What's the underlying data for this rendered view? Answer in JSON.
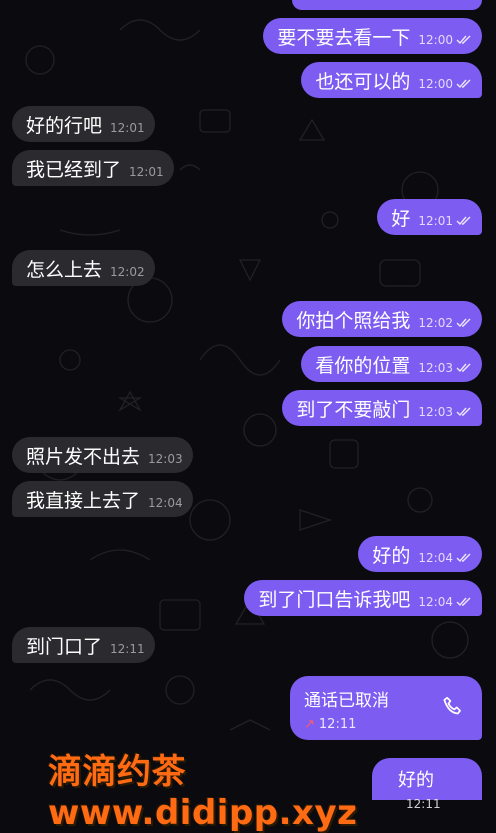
{
  "colors": {
    "outgoing": "#7d5cf2",
    "incoming": "#2a2a2f",
    "background": "#0b0b0f",
    "missed": "#ff5b6b",
    "watermark": "#ff6a13"
  },
  "messages": [
    {
      "text": "要不要去看一下",
      "time": "12:00",
      "dir": "out"
    },
    {
      "text": "也还可以的",
      "time": "12:00",
      "dir": "out"
    },
    {
      "text": "好的行吧",
      "time": "12:01",
      "dir": "in"
    },
    {
      "text": "我已经到了",
      "time": "12:01",
      "dir": "in"
    },
    {
      "text": "好",
      "time": "12:01",
      "dir": "out"
    },
    {
      "text": "怎么上去",
      "time": "12:02",
      "dir": "in"
    },
    {
      "text": "你拍个照给我",
      "time": "12:02",
      "dir": "out"
    },
    {
      "text": "看你的位置",
      "time": "12:03",
      "dir": "out"
    },
    {
      "text": "到了不要敲门",
      "time": "12:03",
      "dir": "out"
    },
    {
      "text": "照片发不出去",
      "time": "12:03",
      "dir": "in"
    },
    {
      "text": "我直接上去了",
      "time": "12:04",
      "dir": "in"
    },
    {
      "text": "好的",
      "time": "12:04",
      "dir": "out"
    },
    {
      "text": "到了门口告诉我吧",
      "time": "12:04",
      "dir": "out"
    },
    {
      "text": "到门口了",
      "time": "12:11",
      "dir": "in"
    }
  ],
  "call": {
    "title": "通话已取消",
    "time": "12:11",
    "icon": "phone-icon",
    "direction_icon": "outgoing-arrow-icon"
  },
  "last_partial": {
    "text": "好的",
    "time": "12:11"
  },
  "watermark": "滴滴约茶 www.didipp.xyz"
}
